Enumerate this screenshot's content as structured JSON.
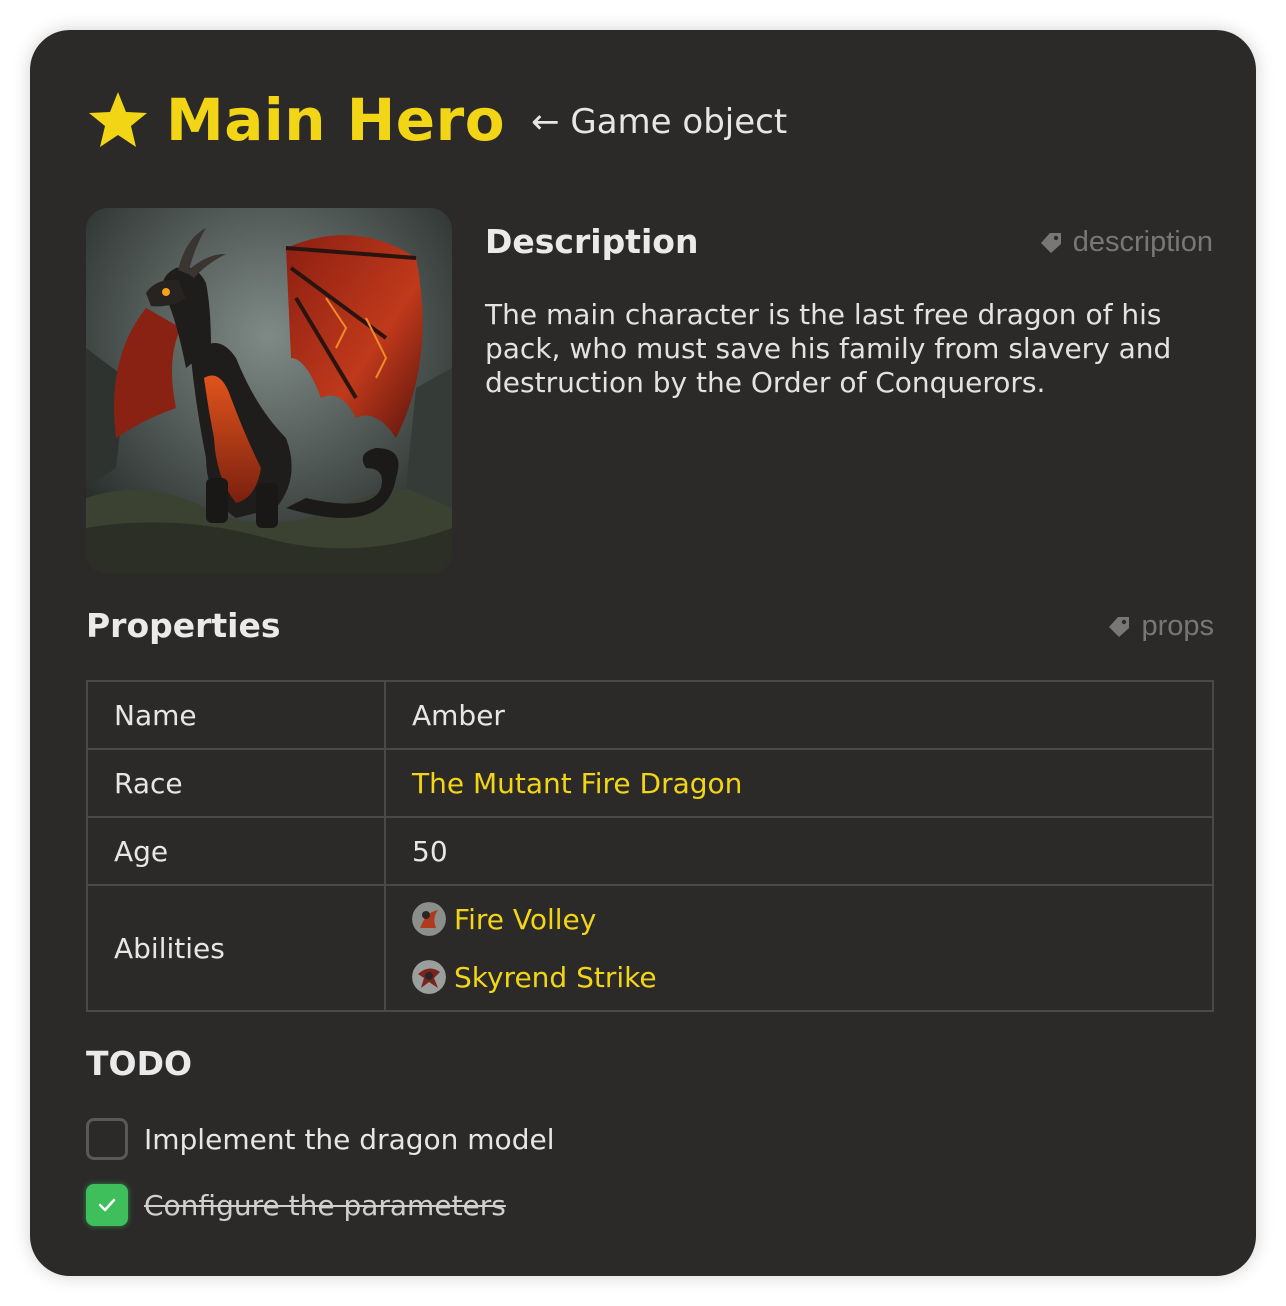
{
  "header": {
    "title": "Main Hero",
    "subtitle": "← Game object",
    "star_color": "#f2d515"
  },
  "image": {
    "alt": "dragon-portrait"
  },
  "description": {
    "title": "Description",
    "tag": "description",
    "text": "The main character is the last free dragon of his pack, who must save his family from slavery and destruction by the Order of Conquerors."
  },
  "properties": {
    "title": "Properties",
    "tag": "props",
    "rows": [
      {
        "key": "Name",
        "value": "Amber"
      },
      {
        "key": "Race",
        "value": "The Mutant Fire Dragon"
      },
      {
        "key": "Age",
        "value": "50"
      },
      {
        "key": "Abilities",
        "abilities": [
          "Fire Volley",
          "Skyrend Strike"
        ]
      }
    ],
    "link_color": "#f2d515"
  },
  "todo": {
    "title": "TODO",
    "items": [
      {
        "label": "Implement the dragon model",
        "checked": false
      },
      {
        "label": "Configure the parameters",
        "checked": true
      }
    ],
    "check_color": "#3fbf5c"
  }
}
